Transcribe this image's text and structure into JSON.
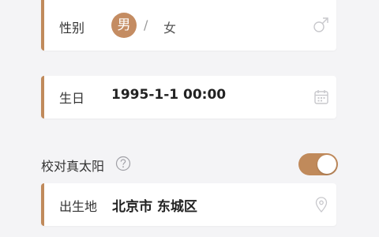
{
  "gender": {
    "label": "性别",
    "male": "男",
    "separator": "/",
    "female": "女",
    "selected": "男"
  },
  "birthday": {
    "label": "生日",
    "value": "1995-1-1 00:00"
  },
  "calibrate": {
    "label": "校对真太阳",
    "enabled": true
  },
  "birthplace": {
    "label": "出生地",
    "value": "北京市 东城区"
  },
  "colors": {
    "accent": "#c08a5b",
    "background": "#f4f4f6"
  },
  "icons": [
    "male-icon",
    "calendar-icon",
    "help-icon",
    "location-pin-icon"
  ]
}
